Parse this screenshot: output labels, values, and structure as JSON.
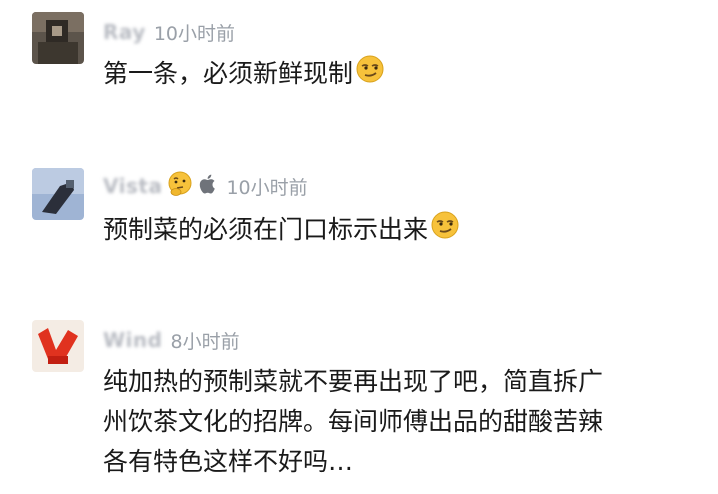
{
  "comments": [
    {
      "username": "Ray",
      "time": "10小时前",
      "text": "第一条，必须新鲜现制",
      "emoji": "smirk-emoji"
    },
    {
      "username": "Vista",
      "user_emoji": "thinking-face-emoji",
      "device_icon": "apple-icon",
      "time": "10小时前",
      "text": "预制菜的必须在门口标示出来",
      "emoji": "smirk-emoji"
    },
    {
      "username": "Wind",
      "time": "8小时前",
      "text_lines": [
        "纯加热的预制菜就不要再出现了吧，简直拆广",
        "州饮茶文化的招牌。每间师傅出品的甜酸苦辣",
        "各有特色这样不好吗…"
      ]
    }
  ],
  "colors": {
    "username": "#b9bcc3",
    "time": "#9aa0a8",
    "text": "#1a1a1a",
    "emoji_face": "#f7c23b"
  }
}
